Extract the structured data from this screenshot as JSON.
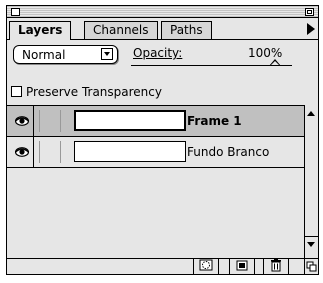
{
  "tabs": [
    {
      "label": "Layers"
    },
    {
      "label": "Channels"
    },
    {
      "label": "Paths"
    }
  ],
  "blend_mode": {
    "selected": "Normal"
  },
  "opacity": {
    "label": "Opacity:",
    "value": "100%"
  },
  "preserve": {
    "label": "Preserve Transparency",
    "checked": false
  },
  "layers": [
    {
      "name": "Frame 1",
      "selected": true
    },
    {
      "name": "Fundo Branco",
      "selected": false
    }
  ],
  "icons": {
    "eye": "eye-icon",
    "new_mask": "mask-icon",
    "new_layer": "new-layer-icon",
    "trash": "trash-icon"
  }
}
